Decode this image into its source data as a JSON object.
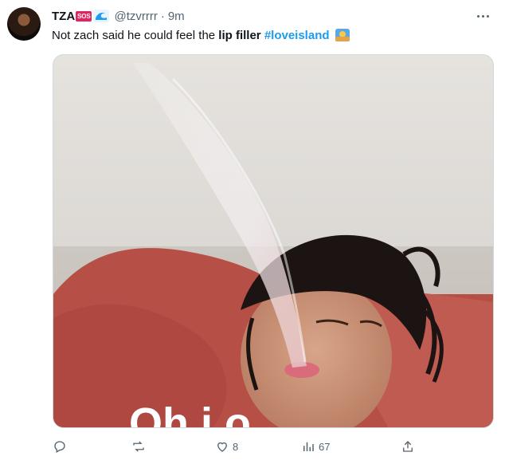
{
  "tweet": {
    "display_name": "TZA",
    "badge": "SOS",
    "handle": "@tzvrrrr",
    "separator": "·",
    "time": "9m",
    "text_before": "Not zach said he could feel the ",
    "text_bold": "lip filler",
    "text_space": " ",
    "hashtag": "#loveisland"
  },
  "media": {
    "overlay_text": "Oh i  o"
  },
  "actions": {
    "reply_icon": "reply-icon",
    "retweet_icon": "retweet-icon",
    "like_icon": "heart-icon",
    "like_count": "8",
    "views_icon": "views-icon",
    "views_count": "67",
    "share_icon": "share-icon"
  },
  "colors": {
    "link": "#1d9bf0",
    "muted": "#536471",
    "badge": "#e0245e"
  }
}
